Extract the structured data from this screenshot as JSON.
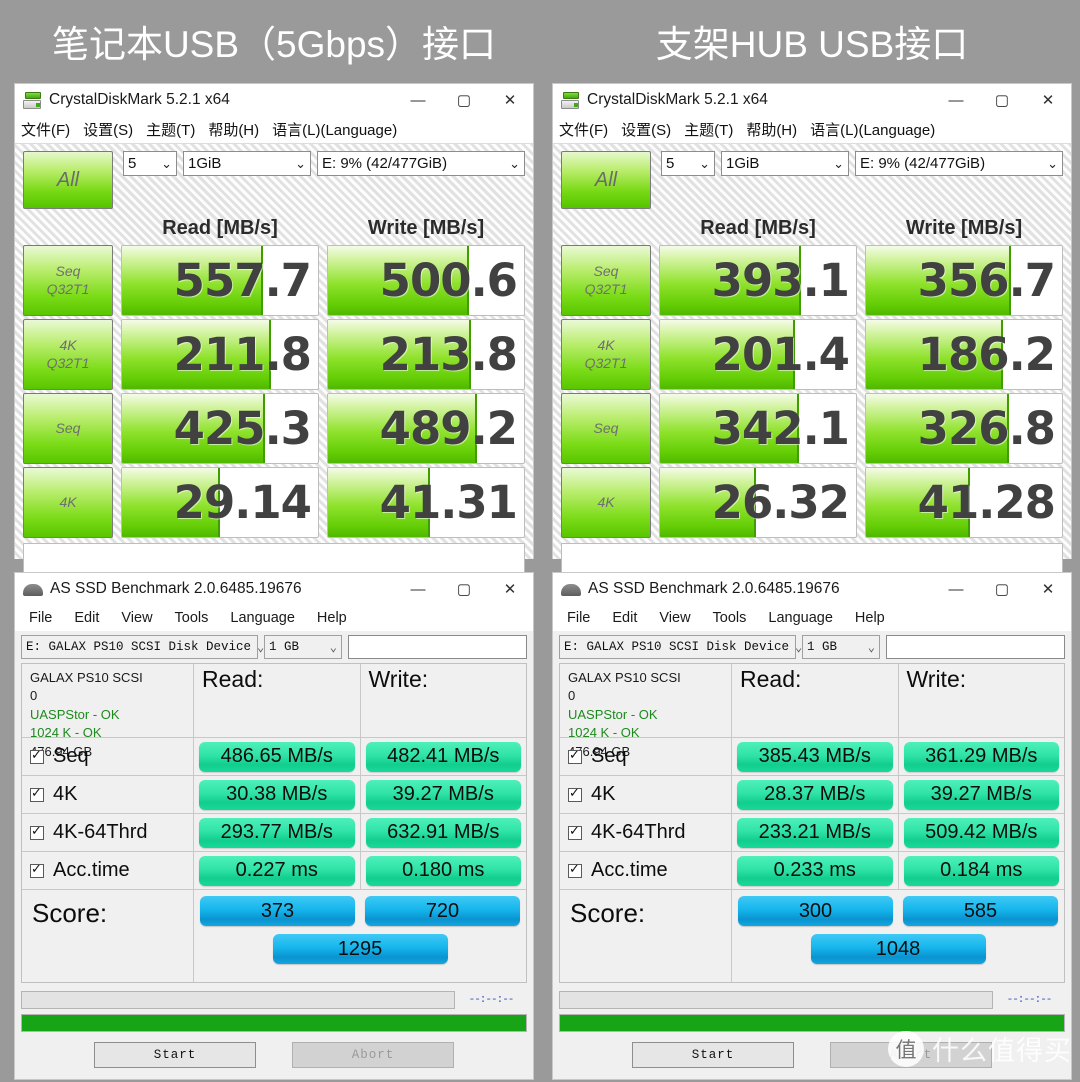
{
  "captions": {
    "left": "笔记本USB（5Gbps）接口",
    "right": "支架HUB  USB接口"
  },
  "crystaldiskmark": {
    "title": "CrystalDiskMark 5.2.1 x64",
    "window_buttons": {
      "minimize": "—",
      "maximize": "▢",
      "close": "✕"
    },
    "menu": [
      "文件(F)",
      "设置(S)",
      "主题(T)",
      "帮助(H)",
      "语言(L)(Language)"
    ],
    "all_button": "All",
    "selects": {
      "count": "5",
      "size": "1GiB",
      "drive": "E: 9% (42/477GiB)",
      "chevron": "⌄"
    },
    "headers": {
      "read": "Read [MB/s]",
      "write": "Write [MB/s]"
    },
    "row_labels": [
      {
        "line1": "Seq",
        "line2": "Q32T1"
      },
      {
        "line1": "4K",
        "line2": "Q32T1"
      },
      {
        "line1": "Seq",
        "line2": ""
      },
      {
        "line1": "4K",
        "line2": ""
      }
    ],
    "left": {
      "read": [
        "557.7",
        "211.8",
        "425.3",
        "29.14"
      ],
      "write": [
        "500.6",
        "213.8",
        "489.2",
        "41.31"
      ],
      "read_fill_pct": [
        72,
        76,
        73,
        50
      ],
      "write_fill_pct": [
        72,
        73,
        76,
        52
      ]
    },
    "right": {
      "read": [
        "393.1",
        "201.4",
        "342.1",
        "26.32"
      ],
      "write": [
        "356.7",
        "186.2",
        "326.8",
        "41.28"
      ],
      "read_fill_pct": [
        72,
        69,
        71,
        49
      ],
      "write_fill_pct": [
        74,
        70,
        73,
        53
      ]
    }
  },
  "asssd": {
    "title": "AS SSD Benchmark 2.0.6485.19676",
    "window_buttons": {
      "minimize": "—",
      "maximize": "▢",
      "close": "✕"
    },
    "menu": [
      "File",
      "Edit",
      "View",
      "Tools",
      "Language",
      "Help"
    ],
    "selects": {
      "drive": "E: GALAX PS10 SCSI Disk Device",
      "size": "1 GB",
      "chevron": "⌄",
      "note": ""
    },
    "info": {
      "name": "GALAX PS10 SCSI",
      "fw": "0",
      "driver": "UASPStor - OK",
      "align": "1024 K - OK",
      "capacity": "476.94 GB"
    },
    "col_read": "Read:",
    "col_write": "Write:",
    "row_names": [
      "Seq",
      "4K",
      "4K-64Thrd",
      "Acc.time"
    ],
    "score_label": "Score:",
    "left": {
      "read": [
        "486.65 MB/s",
        "30.38 MB/s",
        "293.77 MB/s",
        "0.227 ms"
      ],
      "write": [
        "482.41 MB/s",
        "39.27 MB/s",
        "632.91 MB/s",
        "0.180 ms"
      ],
      "score_read": "373",
      "score_write": "720",
      "score_total": "1295"
    },
    "right": {
      "read": [
        "385.43 MB/s",
        "28.37 MB/s",
        "233.21 MB/s",
        "0.233 ms"
      ],
      "write": [
        "361.29 MB/s",
        "39.27 MB/s",
        "509.42 MB/s",
        "0.184 ms"
      ],
      "score_read": "300",
      "score_write": "585",
      "score_total": "1048"
    },
    "elapsed": "--:--:--",
    "start_button": "Start",
    "abort_button": "Abort"
  },
  "watermark": {
    "mark": "值",
    "text": "什么值得买"
  },
  "colors": {
    "background": "#9a9a9a",
    "cdm_green": "#7cdc18",
    "assd_pill_green": "#24dda0",
    "assd_pill_blue": "#16b6ec",
    "progress_green": "#17a517"
  }
}
